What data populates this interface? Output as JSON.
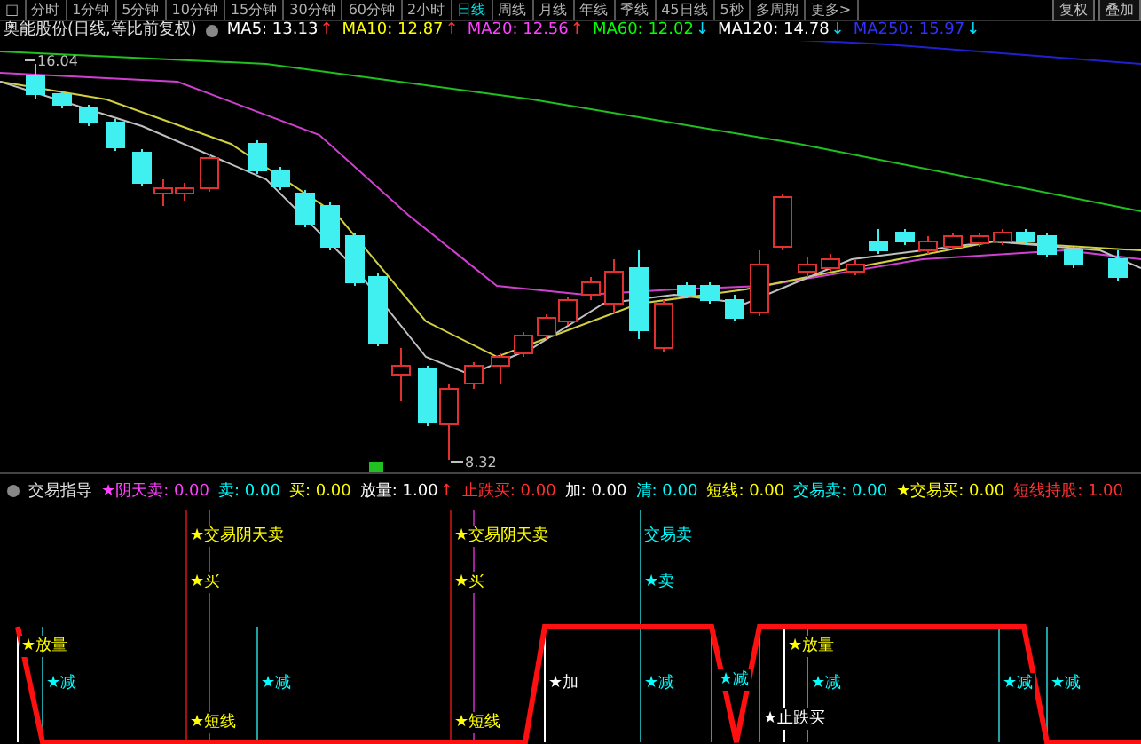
{
  "menu": {
    "items": [
      {
        "label": "□",
        "selected": false
      },
      {
        "label": "分时",
        "selected": false
      },
      {
        "label": "1分钟",
        "selected": false
      },
      {
        "label": "5分钟",
        "selected": false
      },
      {
        "label": "10分钟",
        "selected": false
      },
      {
        "label": "15分钟",
        "selected": false
      },
      {
        "label": "30分钟",
        "selected": false
      },
      {
        "label": "60分钟",
        "selected": false
      },
      {
        "label": "2小时",
        "selected": false
      },
      {
        "label": "日线",
        "selected": true
      },
      {
        "label": "周线",
        "selected": false
      },
      {
        "label": "月线",
        "selected": false
      },
      {
        "label": "年线",
        "selected": false
      },
      {
        "label": "季线",
        "selected": false
      },
      {
        "label": "45日线",
        "selected": false
      },
      {
        "label": "5秒",
        "selected": false
      },
      {
        "label": "多周期",
        "selected": false
      },
      {
        "label": "更多>",
        "selected": false
      }
    ],
    "right_buttons": [
      "复权",
      "叠加"
    ]
  },
  "price_header": {
    "title": "奥能股份(日线,等比前复权)",
    "indicators": [
      {
        "label": "MA5: 13.13",
        "arrow": {
          "text": "↑",
          "color": "#ff3030"
        },
        "color": "#ffffff"
      },
      {
        "label": "MA10: 12.87",
        "arrow": {
          "text": "↑",
          "color": "#ff3030"
        },
        "color": "#ffff00"
      },
      {
        "label": "MA20: 12.56",
        "arrow": {
          "text": "↑",
          "color": "#ff3030"
        },
        "color": "#ff40ff"
      },
      {
        "label": "MA60: 12.02",
        "arrow": {
          "text": "↓",
          "color": "#00e0ff"
        },
        "color": "#00ff00"
      },
      {
        "label": "MA120: 14.78",
        "arrow": {
          "text": "↓",
          "color": "#00e0ff"
        },
        "color": "#ffffff"
      },
      {
        "label": "MA250: 15.97",
        "arrow": {
          "text": "↓",
          "color": "#00e0ff"
        },
        "color": "#3030ff"
      }
    ]
  },
  "main_chart": {
    "high_label": "16.04",
    "low_label": "8.32"
  },
  "indicator_header": {
    "title": "交易指导",
    "values": [
      {
        "label": "★阴天卖: 0.00",
        "color": "#ff40ff"
      },
      {
        "label": "卖: 0.00",
        "color": "#00ffff"
      },
      {
        "label": "买: 0.00",
        "color": "#ffff00"
      },
      {
        "label": "放量: 1.00",
        "color": "#ffffff",
        "arrow": "↑"
      },
      {
        "label": "止跌买: 0.00",
        "color": "#ff3030"
      },
      {
        "label": "加: 0.00",
        "color": "#ffffff"
      },
      {
        "label": "清: 0.00",
        "color": "#00ffff"
      },
      {
        "label": "短线: 0.00",
        "color": "#ffff00"
      },
      {
        "label": "交易卖: 0.00",
        "color": "#00ffff"
      },
      {
        "label": "★交易买: 0.00",
        "color": "#ffff00"
      },
      {
        "label": "短线持股: 1.00",
        "color": "#ff3030"
      }
    ]
  },
  "indicator_chart": {
    "annotations": [
      {
        "text": "★交易阴天卖",
        "color": "#ffff00"
      },
      {
        "text": "★交易阴天卖",
        "color": "#ffff00"
      },
      {
        "text": "交易卖",
        "color": "#00ffff"
      },
      {
        "text": "★买",
        "color": "#ffff00"
      },
      {
        "text": "★买",
        "color": "#ffff00"
      },
      {
        "text": "★卖",
        "color": "#00ffff"
      },
      {
        "text": "★放量",
        "color": "#ffff00"
      },
      {
        "text": "★放量",
        "color": "#ffff00"
      },
      {
        "text": "★减",
        "color": "#00ffff"
      },
      {
        "text": "★减",
        "color": "#00ffff"
      },
      {
        "text": "★加",
        "color": "#ffffff"
      },
      {
        "text": "★减",
        "color": "#00ffff"
      },
      {
        "text": "★减",
        "color": "#00ffff"
      },
      {
        "text": "★减",
        "color": "#00ffff"
      },
      {
        "text": "★减",
        "color": "#00ffff"
      },
      {
        "text": "★减",
        "color": "#00ffff"
      },
      {
        "text": "★短线",
        "color": "#ffff00"
      },
      {
        "text": "★短线",
        "color": "#ffff00"
      },
      {
        "text": "★止跌买",
        "color": "#ffffff"
      }
    ]
  }
}
